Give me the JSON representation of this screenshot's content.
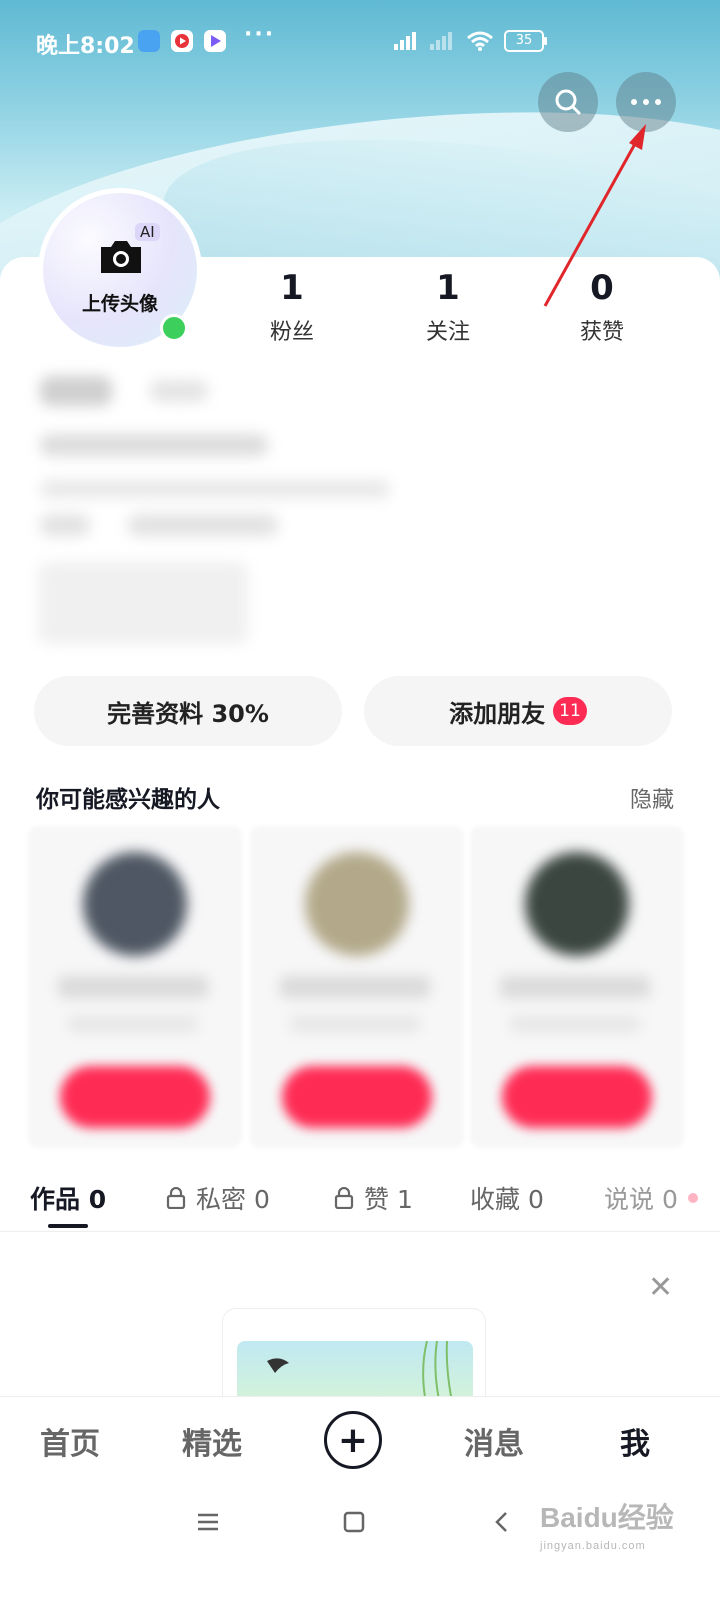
{
  "status_bar": {
    "time": "晚上8:02",
    "battery": "35",
    "more": "···"
  },
  "header": {
    "search_icon": "search-icon",
    "more_icon": "more-icon"
  },
  "profile": {
    "avatar_ai": "AI",
    "avatar_upload": "上传头像",
    "stats": [
      {
        "num": "1",
        "label": "粉丝"
      },
      {
        "num": "1",
        "label": "关注"
      },
      {
        "num": "0",
        "label": "获赞"
      }
    ]
  },
  "actions": {
    "complete_profile": "完善资料 30%",
    "add_friends": "添加朋友",
    "add_friends_badge": "11"
  },
  "recommend": {
    "title": "你可能感兴趣的人",
    "hide": "隐藏"
  },
  "tabs": [
    {
      "label": "作品 0"
    },
    {
      "label": "私密 0"
    },
    {
      "label": "赞 1"
    },
    {
      "label": "收藏 0"
    },
    {
      "label": "说说 0"
    }
  ],
  "bottom_nav": {
    "home": "首页",
    "featured": "精选",
    "create": "+",
    "messages": "消息",
    "me": "我"
  },
  "watermark": {
    "text": "Baidu经验",
    "url": "jingyan.baidu.com"
  },
  "colors": {
    "accent": "#fe2c55",
    "online": "#3ccf5b",
    "arrow": "#e0262b"
  }
}
